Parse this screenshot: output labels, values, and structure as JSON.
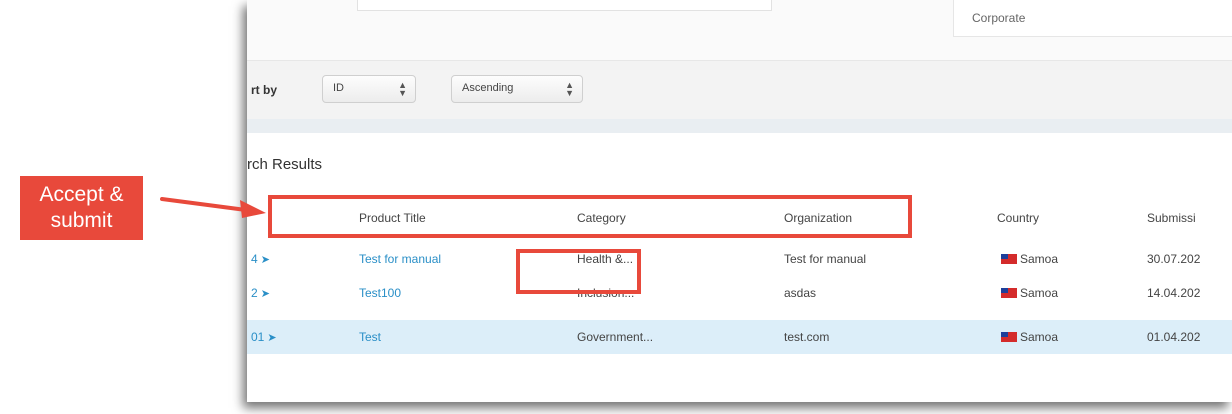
{
  "top": {
    "organization_type_value": "Corporate"
  },
  "sort": {
    "label": "rt by",
    "field_value": "ID",
    "order_value": "Ascending"
  },
  "results": {
    "title": "rch Results",
    "columns": [
      "Product Title",
      "Category",
      "Organization",
      "Country",
      "Submissi"
    ],
    "rows": [
      {
        "id": "4",
        "title": "Test for manual",
        "category": "Health &...",
        "organization": "Test for manual",
        "country": "Samoa",
        "date": "30.07.202"
      },
      {
        "id": "2",
        "title": "Test100",
        "category": "Inclusion...",
        "organization": "asdas",
        "country": "Samoa",
        "date": "14.04.202"
      },
      {
        "id": "01",
        "title": "Test",
        "category": "Government...",
        "organization": "test.com",
        "country": "Samoa",
        "date": "01.04.202"
      }
    ]
  },
  "annotation": {
    "callout_line1": "Accept &",
    "callout_line2": "submit",
    "color": "#e8493b"
  },
  "colors": {
    "link": "#2a8fc7",
    "selected_row": "#dceef9"
  }
}
